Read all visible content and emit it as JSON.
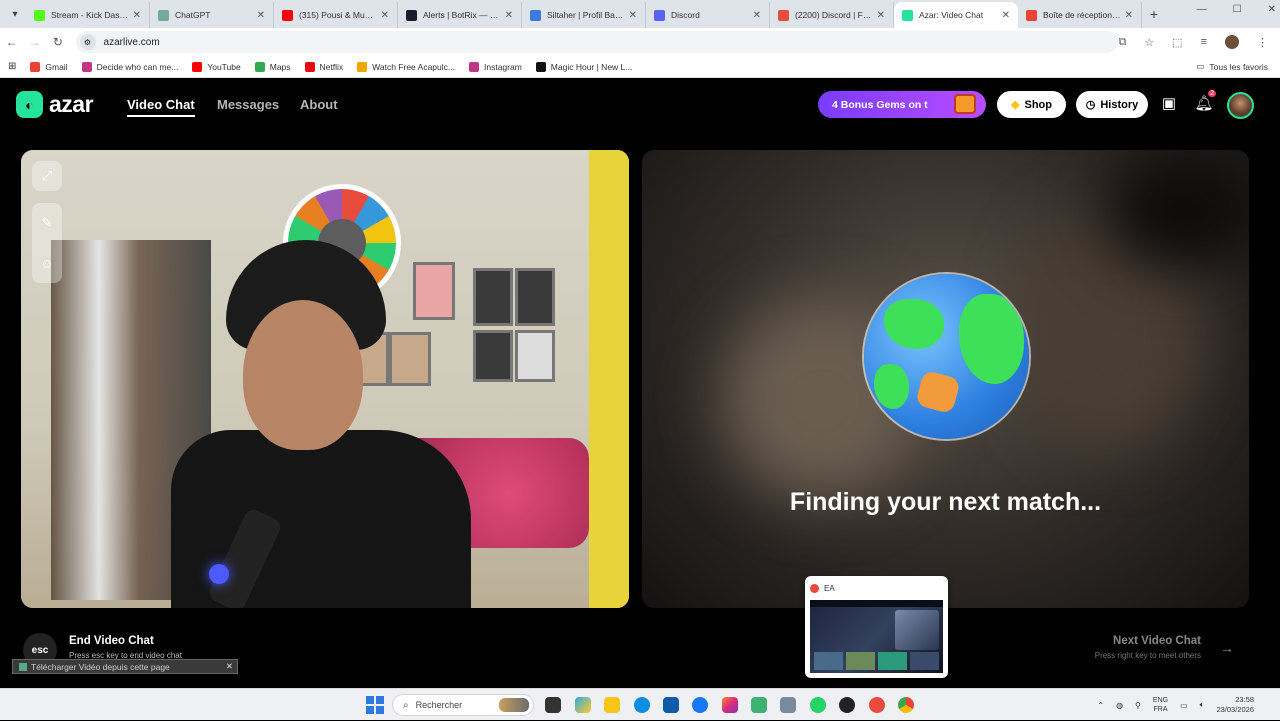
{
  "browser": {
    "tabs": [
      {
        "title": "Stream - Kick Dashb",
        "color": "#53fc18",
        "active": false
      },
      {
        "title": "ChatGPT",
        "color": "#74aa9c",
        "active": false
      },
      {
        "title": "(315) Pousi & Muslim",
        "color": "#ff0000",
        "active": false
      },
      {
        "title": "Alerts | BotRix — Clo",
        "color": "#1a1a2e",
        "active": false
      },
      {
        "title": "Siltaher | Profil Bakch",
        "color": "#3b7be0",
        "active": false
      },
      {
        "title": "Discord",
        "color": "#5865f2",
        "active": false
      },
      {
        "title": "(2200) Discord | Frien",
        "color": "#e74c3c",
        "active": false
      },
      {
        "title": "Azar: Video Chat",
        "color": "#25e39a",
        "active": true
      },
      {
        "title": "Boîte de réception (3",
        "color": "#ea4335",
        "active": false
      }
    ],
    "url": "azarlive.com",
    "bookmarks": [
      {
        "label": "Gmail",
        "color": "#ea4335"
      },
      {
        "label": "Decide who can me...",
        "color": "#c13584"
      },
      {
        "label": "YouTube",
        "color": "#ff0000"
      },
      {
        "label": "Maps",
        "color": "#34a853"
      },
      {
        "label": "Netflix",
        "color": "#e50914"
      },
      {
        "label": "Watch Free Acapulc...",
        "color": "#f0a500"
      },
      {
        "label": "Instagram",
        "color": "#c13584"
      },
      {
        "label": "Magic Hour | New L...",
        "color": "#111111"
      }
    ],
    "all_bookmarks": "Tous les favoris"
  },
  "app": {
    "logo_text": "azar",
    "nav": {
      "video_chat": "Video Chat",
      "messages": "Messages",
      "about": "About"
    },
    "gems_button": "4 Bonus Gems on t",
    "shop": "Shop",
    "history": "History",
    "notification_count": "2",
    "finding_text": "Finding your next match...",
    "end": {
      "key": "esc",
      "title": "End Video Chat",
      "subtitle": "Press esc key to end video chat"
    },
    "next": {
      "title": "Next Video Chat",
      "subtitle": "Press right key to meet others"
    },
    "accent": "#25e39a"
  },
  "download_bar": {
    "text": "Télécharger Vidéo depuis cette page"
  },
  "preview": {
    "title": "EA"
  },
  "taskbar": {
    "search_placeholder": "Rechercher",
    "lang_top": "ENG",
    "lang_bottom": "FRA",
    "time": "23:58",
    "date": "23/03/2026"
  }
}
